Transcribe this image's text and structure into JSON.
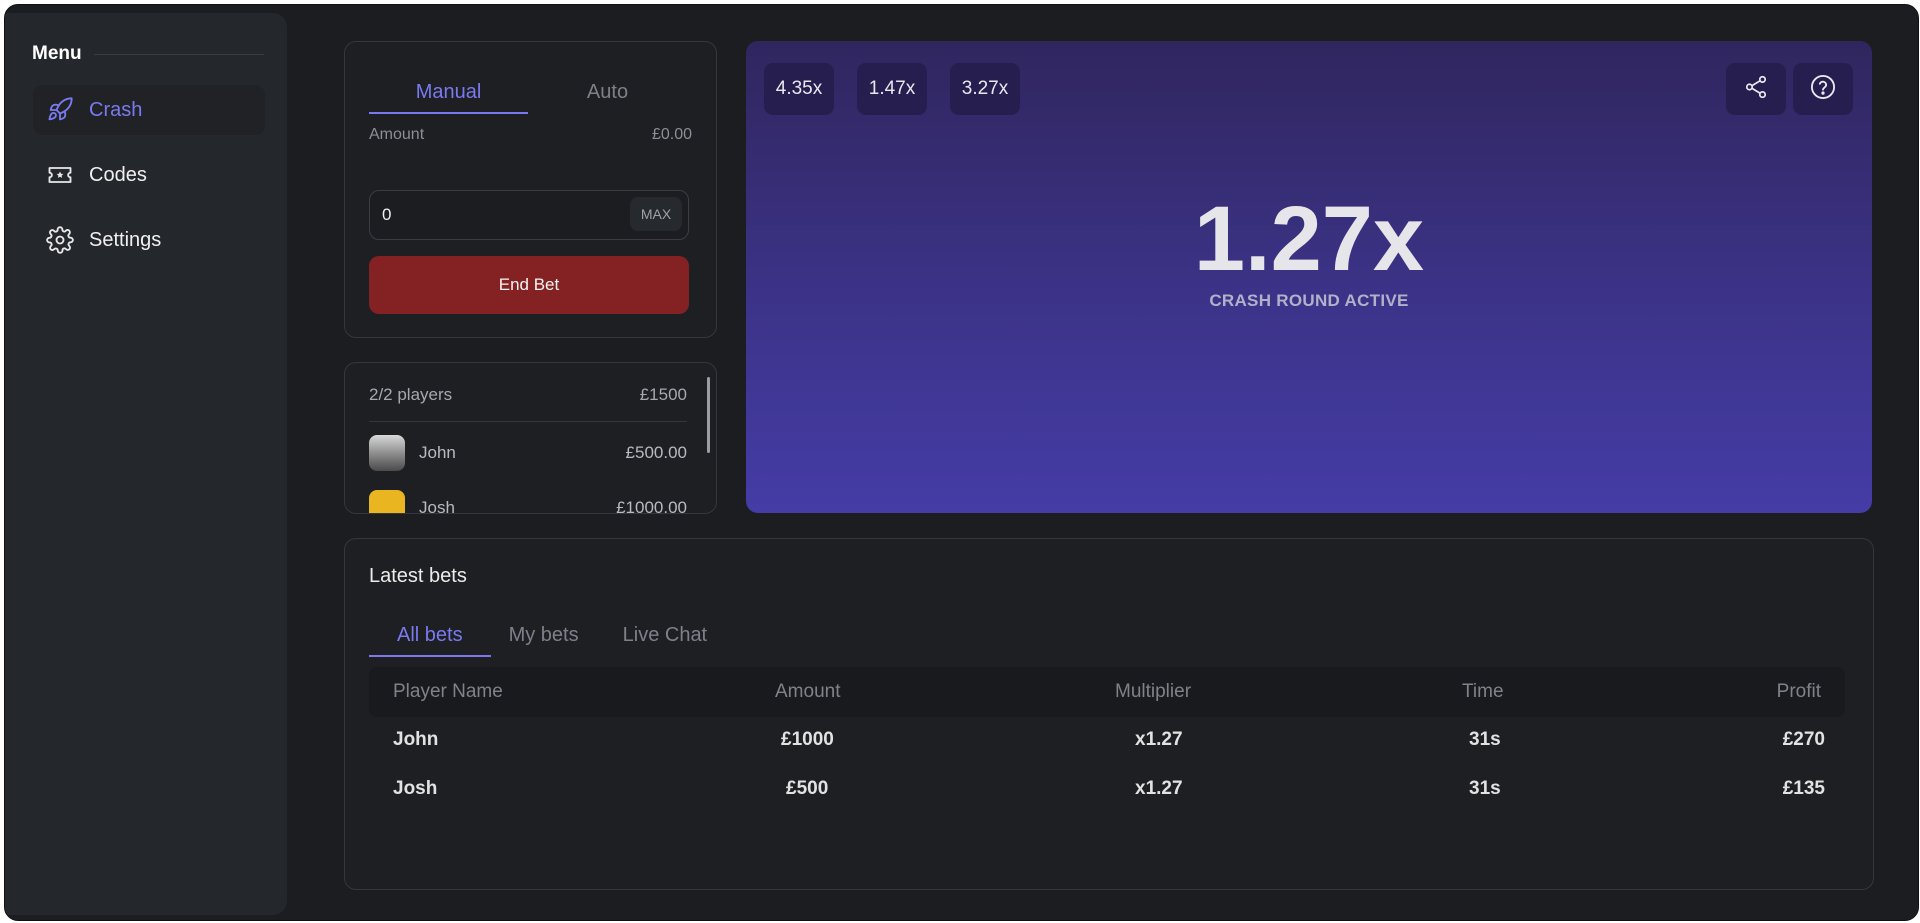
{
  "sidebar": {
    "title": "Menu",
    "items": [
      {
        "label": "Crash",
        "icon": "rocket-icon",
        "active": true
      },
      {
        "label": "Codes",
        "icon": "ticket-icon",
        "active": false
      },
      {
        "label": "Settings",
        "icon": "gear-icon",
        "active": false
      }
    ]
  },
  "bet_panel": {
    "tabs": [
      "Manual",
      "Auto"
    ],
    "active_tab": "Manual",
    "amount_label": "Amount",
    "amount_balance": "£0.00",
    "amount_value": "0",
    "max_label": "MAX",
    "end_bet_label": "End Bet"
  },
  "players_panel": {
    "count_label": "2/2 players",
    "total": "£1500",
    "players": [
      {
        "name": "John",
        "amount": "£500.00"
      },
      {
        "name": "Josh",
        "amount": "£1000.00"
      }
    ]
  },
  "game": {
    "history": [
      "4.35x",
      "1.47x",
      "3.27x"
    ],
    "multiplier": "1.27x",
    "status": "CRASH ROUND ACTIVE",
    "buttons": [
      "share-icon",
      "help-icon"
    ]
  },
  "latest_bets": {
    "title": "Latest bets",
    "tabs": [
      "All bets",
      "My bets",
      "Live Chat"
    ],
    "active_tab": "All bets",
    "columns": [
      "Player Name",
      "Amount",
      "Multiplier",
      "Time",
      "Profit"
    ],
    "rows": [
      {
        "player": "John",
        "amount": "£1000",
        "multiplier": "x1.27",
        "time": "31s",
        "profit": "£270"
      },
      {
        "player": "Josh",
        "amount": "£500",
        "multiplier": "x1.27",
        "time": "31s",
        "profit": "£135"
      }
    ]
  },
  "colors": {
    "accent": "#7b79ef",
    "end_bet": "#842223",
    "background": "#1b1d21",
    "sidebar": "#24272c"
  }
}
